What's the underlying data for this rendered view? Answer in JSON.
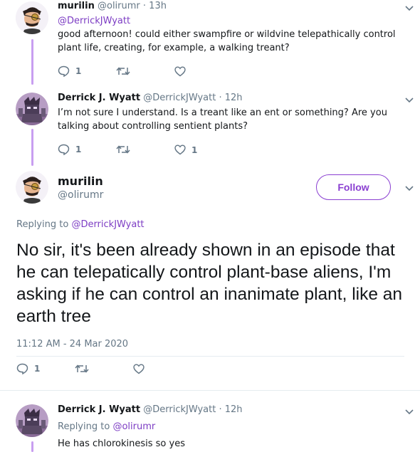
{
  "tweets": [
    {
      "author": "murilin",
      "handle": "@olirumr",
      "time": "· 13h",
      "reply_to": "@DerrickJWyatt",
      "text": "good afternoon! could either swampfire or wildvine telepathically control plant life, creating, for example, a walking treant?",
      "reply_count": "1",
      "retweet_count": "",
      "like_count": ""
    },
    {
      "author": "Derrick J. Wyatt",
      "handle": "@DerrickJWyatt",
      "time": "· 12h",
      "text": "I’m not sure I understand. Is a treant like an ent or something? Are you talking about controlling sentient plants?",
      "reply_count": "1",
      "retweet_count": "",
      "like_count": "1"
    }
  ],
  "main_tweet": {
    "author": "murilin",
    "handle": "@olirumr",
    "follow_label": "Follow",
    "replying_label": "Replying to",
    "replying_to": "@DerrickJWyatt",
    "text": "No sir, it's been already shown in an episode that he can telepatically control plant-base aliens, I'm asking if he can control an inanimate plant, like an earth tree",
    "timestamp": "11:12 AM - 24 Mar 2020",
    "reply_count": "1",
    "retweet_count": "",
    "like_count": ""
  },
  "reply": {
    "author": "Derrick J. Wyatt",
    "handle": "@DerrickJWyatt",
    "time": "· 12h",
    "replying_label": "Replying to",
    "replying_to": "@olirumr",
    "text": "He has chlorokinesis so yes"
  },
  "icons": {
    "reply": "reply-icon",
    "retweet": "retweet-icon",
    "like": "heart-icon",
    "more": "chevron-down-icon"
  },
  "colors": {
    "accent": "#8a3fd1",
    "link": "#7d3dc4",
    "thread_line": "#c89ef0",
    "secondary_text": "#657786"
  }
}
